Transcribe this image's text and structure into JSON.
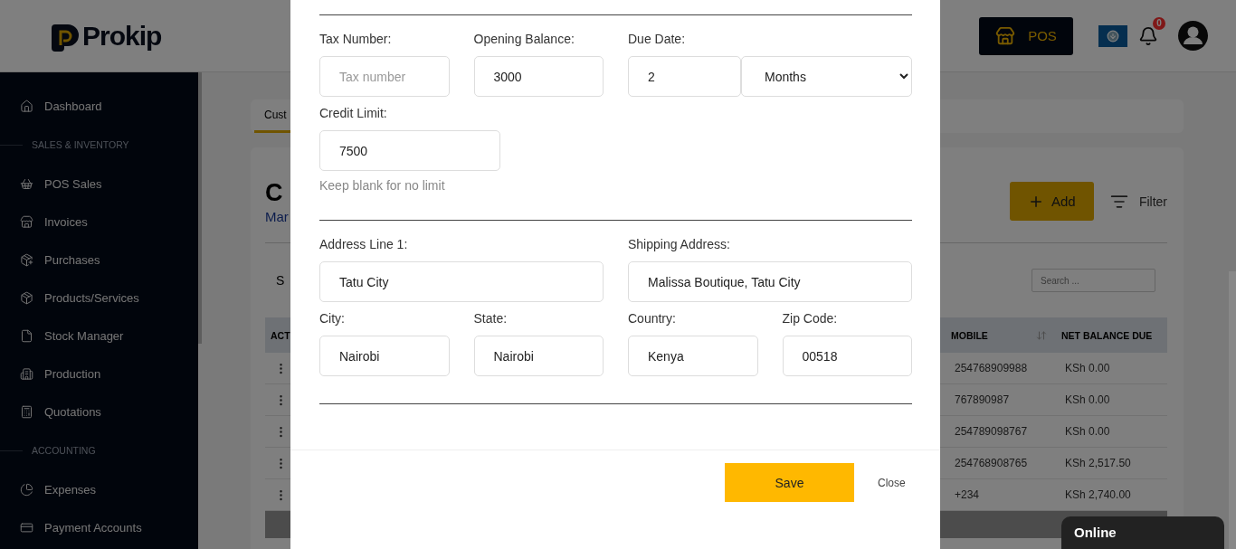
{
  "header": {
    "logo": "Prokip",
    "pos_button": "POS",
    "notification_count": "0"
  },
  "sidebar": {
    "items": [
      {
        "kind": "item",
        "label": "Dashboard"
      },
      {
        "kind": "section",
        "label": "SALES & INVENTORY"
      },
      {
        "kind": "item",
        "label": "POS Sales"
      },
      {
        "kind": "item",
        "label": "Invoices"
      },
      {
        "kind": "item",
        "label": "Purchases"
      },
      {
        "kind": "item",
        "label": "Products/Services"
      },
      {
        "kind": "item",
        "label": "Stock Manager"
      },
      {
        "kind": "item",
        "label": "Production"
      },
      {
        "kind": "item",
        "label": "Quotations"
      },
      {
        "kind": "section",
        "label": "ACCOUNTING"
      },
      {
        "kind": "item",
        "label": "Expenses"
      },
      {
        "kind": "item",
        "label": "Payment Accounts"
      }
    ]
  },
  "tabs": [
    {
      "label": "Cust",
      "selected": true
    }
  ],
  "page": {
    "title": "C",
    "subtitle": "Mar",
    "add_button": "Add",
    "filter_button": "Filter",
    "show_label": "S",
    "search": {
      "placeholder": "Search ..."
    }
  },
  "table": {
    "columns": [
      "ACT",
      "MOBILE",
      "NET BALANCE DUE"
    ],
    "rows": [
      {
        "mobile": "254768909988",
        "balance": "KSh 0.00"
      },
      {
        "mobile": "767890987",
        "balance": "KSh 0.00"
      },
      {
        "mobile": "254789098767",
        "balance": "KSh 0.00"
      },
      {
        "mobile": "254768908765",
        "balance": "KSh 2,517.50"
      },
      {
        "mobile": "+234",
        "balance": "KSh 2,740.00"
      }
    ]
  },
  "modal": {
    "sections": [
      {
        "groups": [
          {
            "fields": [
              {
                "kind": "normal",
                "label": "Tax Number:",
                "placeholder": "Tax number"
              },
              {
                "kind": "normal",
                "label": "Opening Balance:",
                "value": "3000"
              },
              {
                "kind": "duration",
                "label": "Due Date:",
                "value": "2",
                "unit": "Months"
              }
            ]
          },
          {
            "fields": [
              {
                "kind": "medium",
                "label": "Credit Limit:",
                "value": "7500",
                "hint": "Keep blank for no limit"
              }
            ]
          }
        ]
      },
      {
        "groups": [
          {
            "fields": [
              {
                "kind": "wide",
                "label": "Address Line 1:",
                "value": "Tatu City"
              },
              {
                "kind": "wide",
                "label": "Shipping Address:",
                "value": "Malissa Boutique, Tatu City"
              }
            ]
          },
          {
            "fields": [
              {
                "kind": "normal",
                "label": "City:",
                "value": "Nairobi"
              },
              {
                "kind": "normal",
                "label": "State:",
                "value": "Nairobi"
              },
              {
                "kind": "normal",
                "label": "Country:",
                "value": "Kenya"
              },
              {
                "kind": "normal",
                "label": "Zip Code:",
                "value": "00518"
              }
            ]
          }
        ]
      }
    ],
    "save_button": "Save",
    "close_button": "Close"
  },
  "chat": {
    "status": "Online"
  }
}
